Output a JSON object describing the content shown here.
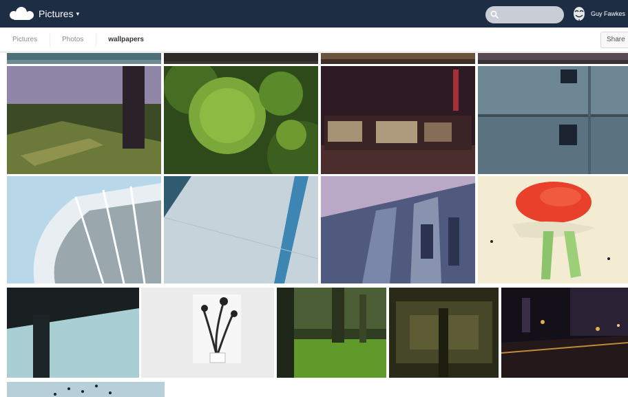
{
  "header": {
    "app_name": "Pictures",
    "search": {
      "placeholder": "",
      "value": ""
    },
    "user_name": "Guy Fawkes",
    "icons": {
      "logo": "cloud-logo-icon",
      "search": "search-icon",
      "avatar": "mask-avatar-icon",
      "caret": "chevron-down-icon"
    },
    "colors": {
      "header_bg": "#1d2d44",
      "search_bg": "#c9ced6"
    }
  },
  "breadcrumb": {
    "items": [
      "Pictures",
      "Photos",
      "wallpapers"
    ],
    "share_label": "Share"
  },
  "gallery": {
    "photos": [
      {
        "subject": "partial-top-1"
      },
      {
        "subject": "partial-top-2"
      },
      {
        "subject": "partial-top-3"
      },
      {
        "subject": "partial-top-4"
      },
      {
        "subject": "tree-shadows-purple"
      },
      {
        "subject": "green-spiky-ball"
      },
      {
        "subject": "dark-building-night"
      },
      {
        "subject": "blue-concrete-wall"
      },
      {
        "subject": "glass-building-curve"
      },
      {
        "subject": "white-facade"
      },
      {
        "subject": "building-looking-up"
      },
      {
        "subject": "tomato-food-plate"
      },
      {
        "subject": "dark-rail-sky"
      },
      {
        "subject": "white-flower-niche"
      },
      {
        "subject": "green-park-trees"
      },
      {
        "subject": "dark-forest-texture"
      },
      {
        "subject": "night-city-lights"
      },
      {
        "subject": "sky-birds"
      }
    ]
  }
}
